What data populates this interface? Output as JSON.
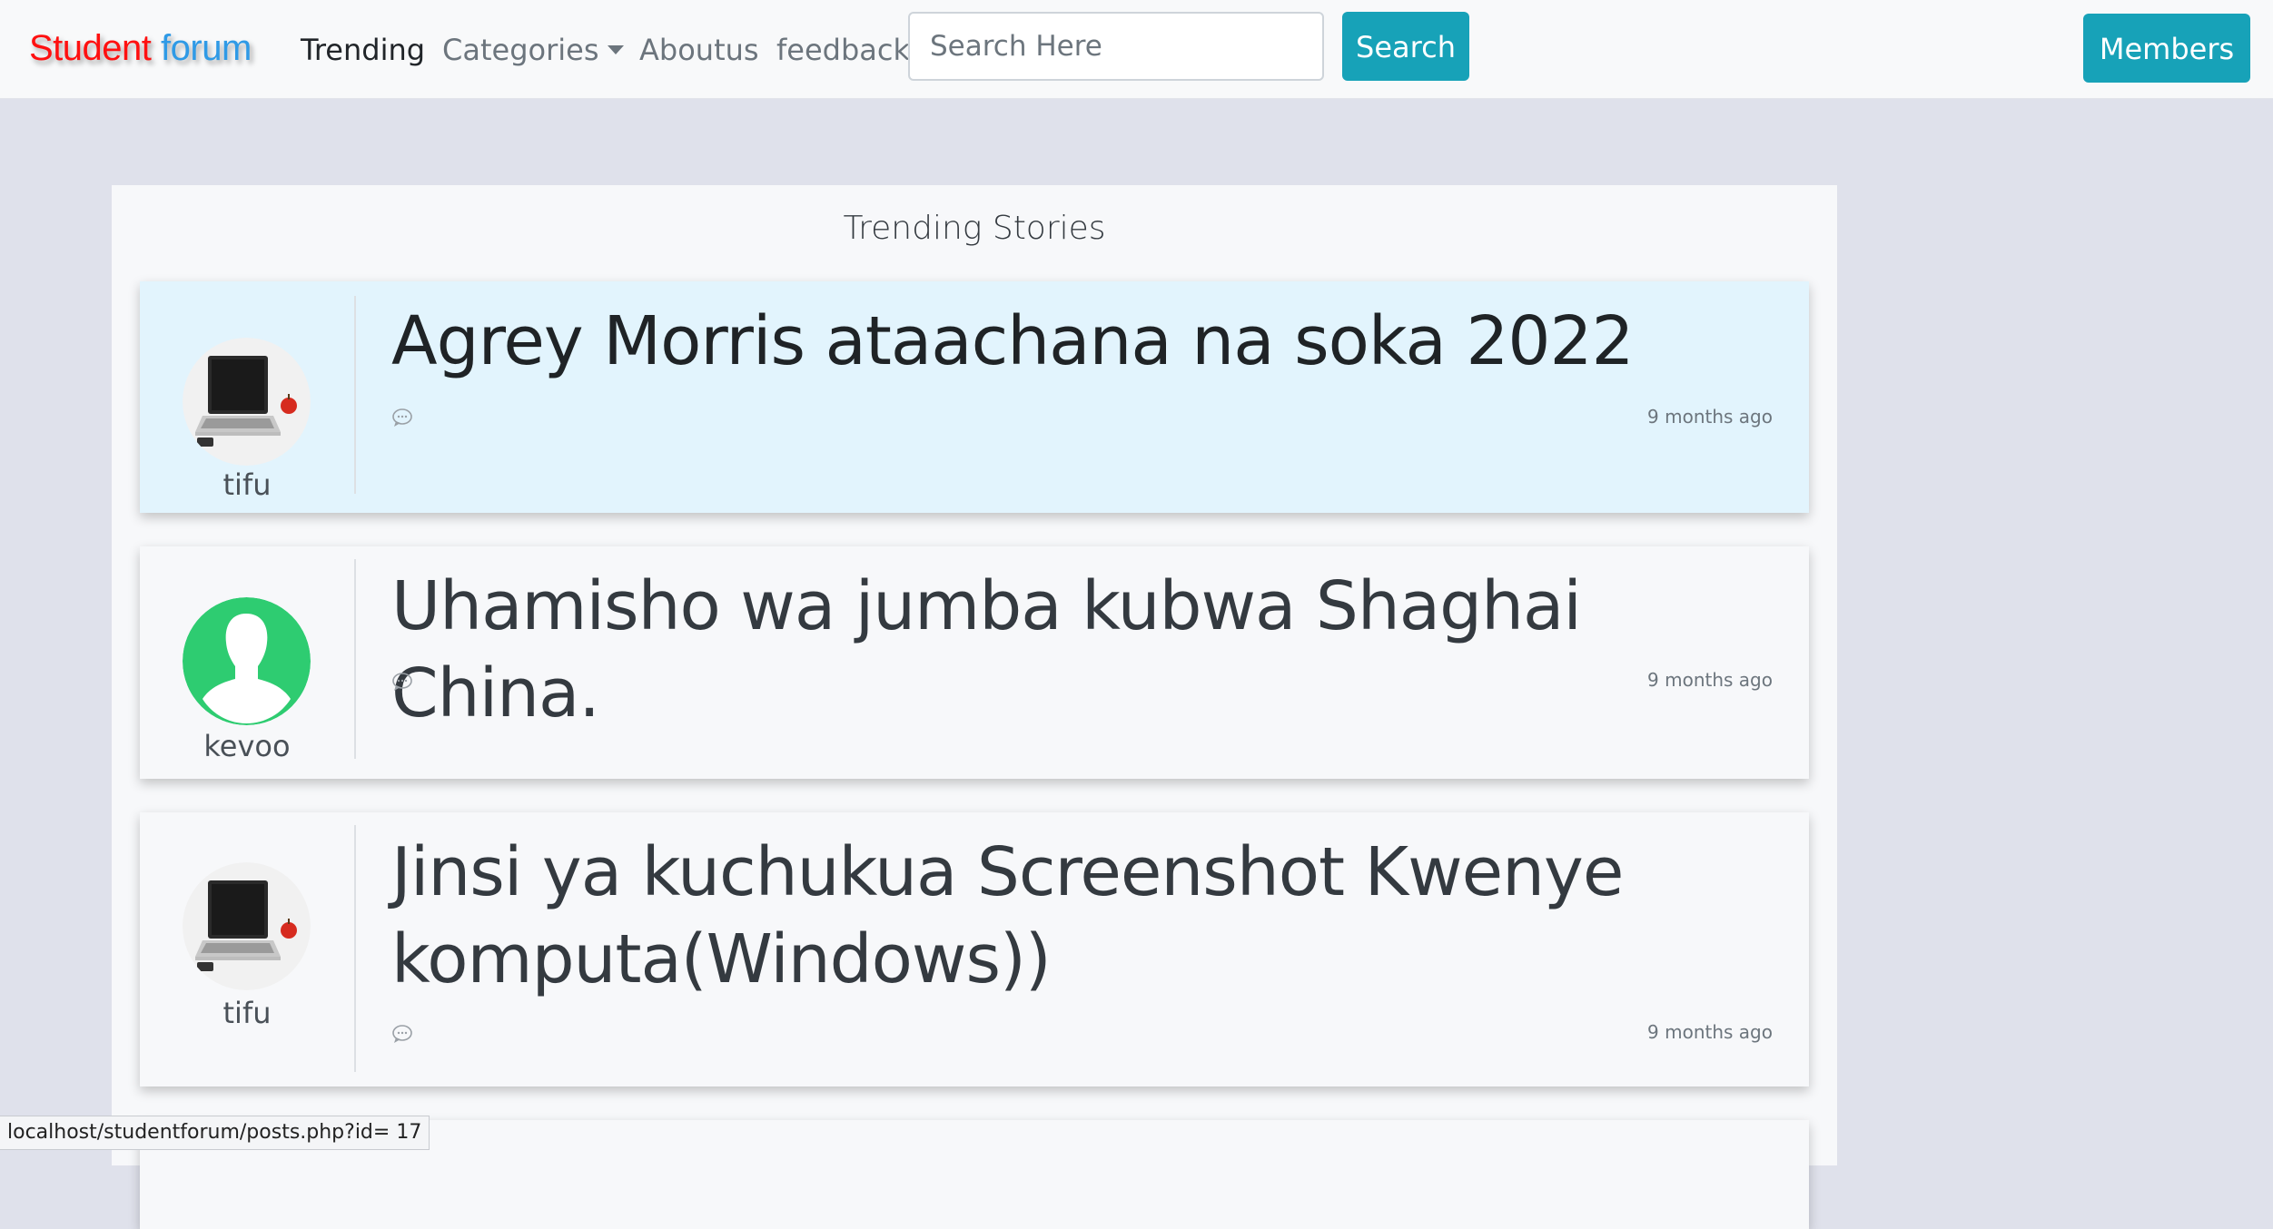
{
  "navbar": {
    "brand_first": "Student",
    "brand_second": "forum",
    "links": {
      "trending": "Trending",
      "categories": "Categories",
      "aboutus": "Aboutus",
      "feedback": "feedback"
    },
    "search": {
      "placeholder": "Search Here",
      "button_label": "Search"
    },
    "members_label": "Members"
  },
  "main": {
    "section_title": "Trending Stories",
    "posts": [
      {
        "author": "tifu",
        "avatar": "laptop-photo",
        "title": "Agrey Morris ataachana na soka 2022",
        "time_ago": "9 months ago",
        "highlighted": true
      },
      {
        "author": "kevoo",
        "avatar": "default-user-silhouette",
        "title": "Uhamisho wa jumba kubwa Shaghai China.",
        "time_ago": "9 months ago",
        "highlighted": false
      },
      {
        "author": "tifu",
        "avatar": "laptop-photo",
        "title": "Jinsi ya kuchukua Screenshot Kwenye komputa(Windows))",
        "time_ago": "9 months ago",
        "highlighted": false
      }
    ]
  },
  "status_bar": {
    "url": "localhost/studentforum/posts.php?id= 17"
  },
  "colors": {
    "brand_red": "#ff1010",
    "brand_blue": "#2f9ae6",
    "button_info": "#17a2b8",
    "highlight_card": "#e2f4fd",
    "page_bg": "#dfe1eb",
    "avatar_green": "#2ecc71"
  }
}
